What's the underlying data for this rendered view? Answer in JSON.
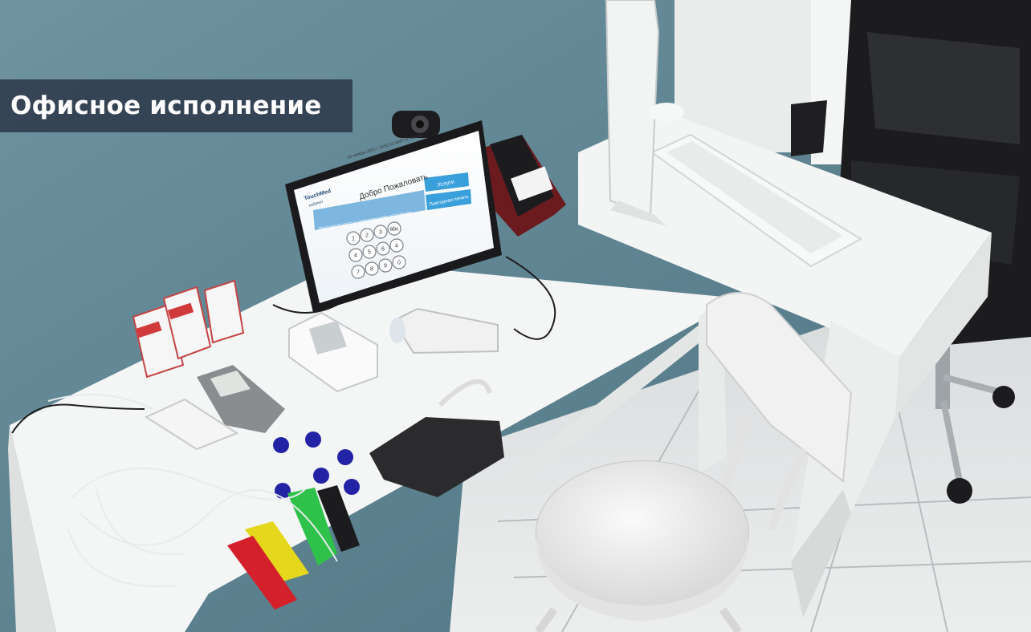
{
  "caption": {
    "title": "Офисное исполнение"
  },
  "kiosk_screen": {
    "header_line": "05 ноября 2021 г. 19:52:13 GMT+3 Москва",
    "logo_text": "TouchMed",
    "logo_subtext": "кабинет",
    "welcome": "Добро Пожаловать",
    "btn_services": "Услуги",
    "btn_repeat": "Повторная печать",
    "card_prompt": "Приложите карту к считывающему устройству",
    "keypad": [
      "1",
      "2",
      "3",
      "abc",
      "4",
      "5",
      "6",
      "4",
      "7",
      "8",
      "9",
      "0"
    ]
  },
  "colors": {
    "wall": "#5e8593",
    "desk": "#f1f2f2",
    "floor": "#d9dbdc",
    "caption_bg": "#323e50",
    "screen_accent": "#3aa0dc"
  }
}
